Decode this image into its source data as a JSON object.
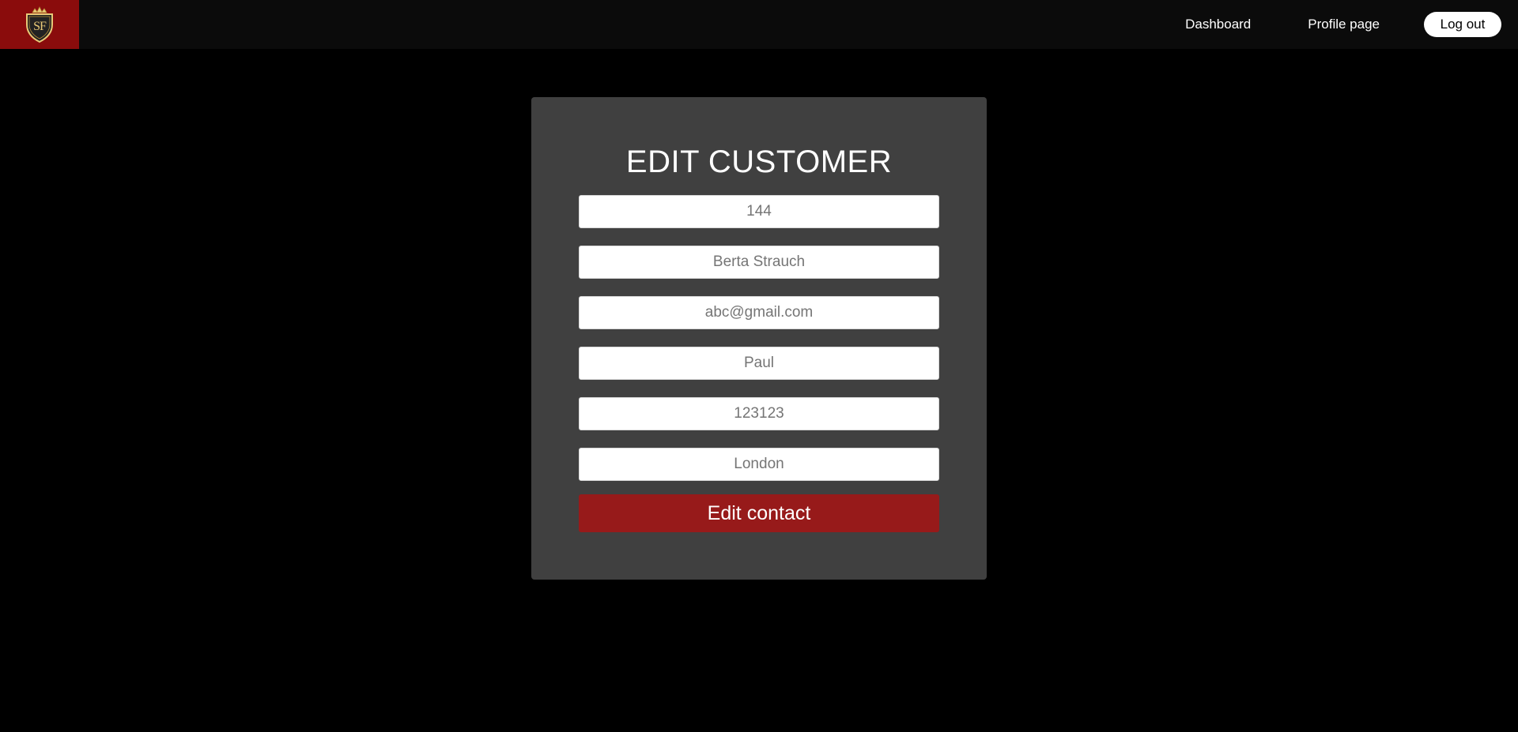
{
  "navbar": {
    "logo_text": "SF",
    "links": [
      {
        "label": "Dashboard"
      },
      {
        "label": "Profile page"
      }
    ],
    "logout_label": "Log out"
  },
  "form": {
    "title": "EDIT CUSTOMER",
    "fields": [
      {
        "placeholder": "144"
      },
      {
        "placeholder": "Berta Strauch"
      },
      {
        "placeholder": "abc@gmail.com"
      },
      {
        "placeholder": "Paul"
      },
      {
        "placeholder": "123123"
      },
      {
        "placeholder": "London"
      }
    ],
    "submit_label": "Edit contact"
  },
  "colors": {
    "brand_red": "#8a0c0c",
    "button_red": "#971a1a",
    "card_bg": "#404040",
    "logo_gold": "#e9c977"
  }
}
